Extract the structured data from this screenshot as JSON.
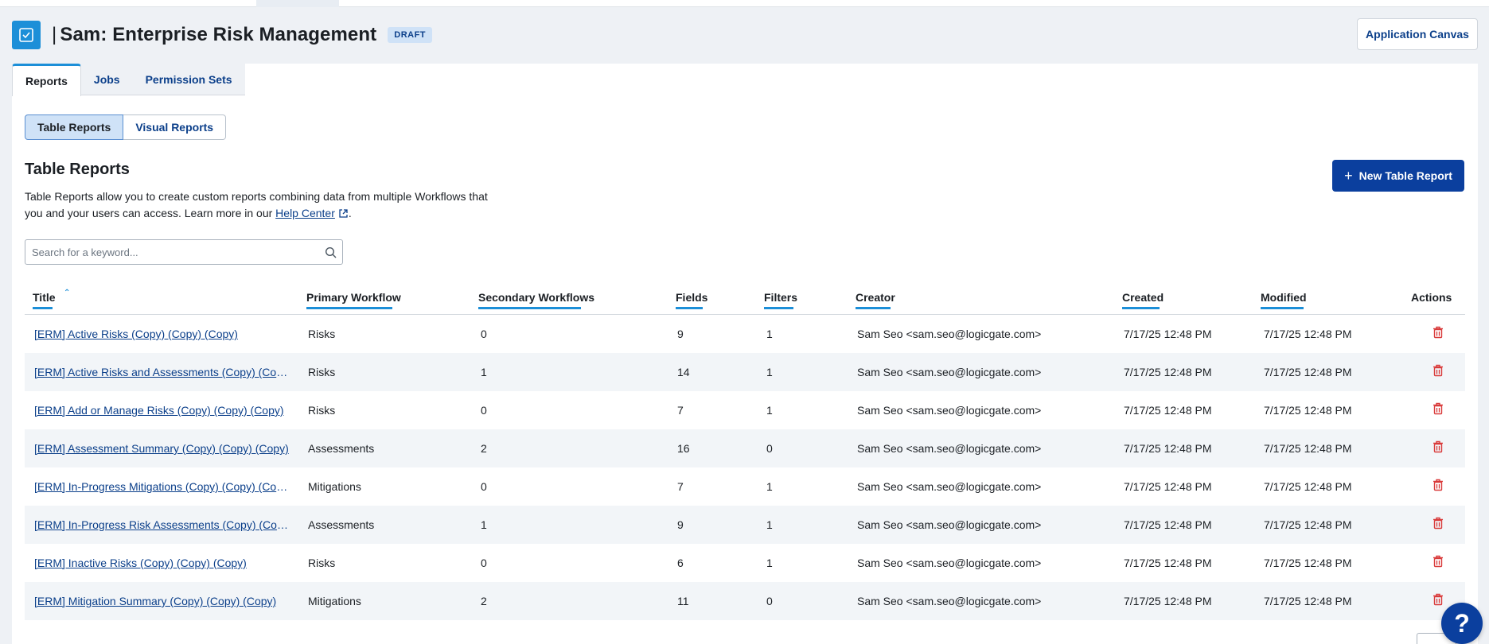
{
  "header": {
    "title": "Sam: Enterprise Risk Management",
    "title_prefix": "|",
    "badge": "DRAFT",
    "app_canvas_label": "Application Canvas",
    "icon": "checkbox-icon"
  },
  "tabs": [
    {
      "label": "Reports",
      "active": true
    },
    {
      "label": "Jobs",
      "active": false
    },
    {
      "label": "Permission Sets",
      "active": false
    }
  ],
  "segmented": {
    "table_reports": "Table Reports",
    "visual_reports": "Visual Reports"
  },
  "section": {
    "title": "Table Reports",
    "desc_part1": "Table Reports allow you to create custom reports combining data from multiple Workflows that you and your users can access. Learn more in our ",
    "help_link": "Help Center",
    "desc_end": ".",
    "new_button": "New Table Report"
  },
  "search": {
    "placeholder": "Search for a keyword...",
    "value": ""
  },
  "table": {
    "headers": {
      "title": "Title",
      "primary": "Primary Workflow",
      "secondary": "Secondary Workflows",
      "fields": "Fields",
      "filters": "Filters",
      "creator": "Creator",
      "created": "Created",
      "modified": "Modified",
      "actions": "Actions"
    },
    "rows": [
      {
        "title": "[ERM] Active Risks (Copy) (Copy) (Copy)",
        "primary": "Risks",
        "secondary": "0",
        "fields": "9",
        "filters": "1",
        "creator": "Sam Seo <sam.seo@logicgate.com>",
        "created": "7/17/25 12:48 PM",
        "modified": "7/17/25 12:48 PM"
      },
      {
        "title": "[ERM] Active Risks and Assessments (Copy) (Copy) (C...",
        "primary": "Risks",
        "secondary": "1",
        "fields": "14",
        "filters": "1",
        "creator": "Sam Seo <sam.seo@logicgate.com>",
        "created": "7/17/25 12:48 PM",
        "modified": "7/17/25 12:48 PM"
      },
      {
        "title": "[ERM] Add or Manage Risks (Copy) (Copy) (Copy)",
        "primary": "Risks",
        "secondary": "0",
        "fields": "7",
        "filters": "1",
        "creator": "Sam Seo <sam.seo@logicgate.com>",
        "created": "7/17/25 12:48 PM",
        "modified": "7/17/25 12:48 PM"
      },
      {
        "title": "[ERM] Assessment Summary (Copy) (Copy) (Copy)",
        "primary": "Assessments",
        "secondary": "2",
        "fields": "16",
        "filters": "0",
        "creator": "Sam Seo <sam.seo@logicgate.com>",
        "created": "7/17/25 12:48 PM",
        "modified": "7/17/25 12:48 PM"
      },
      {
        "title": "[ERM] In-Progress Mitigations (Copy) (Copy) (Copy)",
        "primary": "Mitigations",
        "secondary": "0",
        "fields": "7",
        "filters": "1",
        "creator": "Sam Seo <sam.seo@logicgate.com>",
        "created": "7/17/25 12:48 PM",
        "modified": "7/17/25 12:48 PM"
      },
      {
        "title": "[ERM] In-Progress Risk Assessments (Copy) (Copy) (C...",
        "primary": "Assessments",
        "secondary": "1",
        "fields": "9",
        "filters": "1",
        "creator": "Sam Seo <sam.seo@logicgate.com>",
        "created": "7/17/25 12:48 PM",
        "modified": "7/17/25 12:48 PM"
      },
      {
        "title": "[ERM] Inactive Risks (Copy) (Copy) (Copy)",
        "primary": "Risks",
        "secondary": "0",
        "fields": "6",
        "filters": "1",
        "creator": "Sam Seo <sam.seo@logicgate.com>",
        "created": "7/17/25 12:48 PM",
        "modified": "7/17/25 12:48 PM"
      },
      {
        "title": "[ERM] Mitigation Summary (Copy) (Copy) (Copy)",
        "primary": "Mitigations",
        "secondary": "2",
        "fields": "11",
        "filters": "0",
        "creator": "Sam Seo <sam.seo@logicgate.com>",
        "created": "7/17/25 12:48 PM",
        "modified": "7/17/25 12:48 PM"
      }
    ]
  },
  "help_fab": "?",
  "colors": {
    "accent": "#1c8fd8",
    "primary_button": "#0b3f9e",
    "link": "#0b3f8a",
    "delete": "#d93b3b"
  }
}
